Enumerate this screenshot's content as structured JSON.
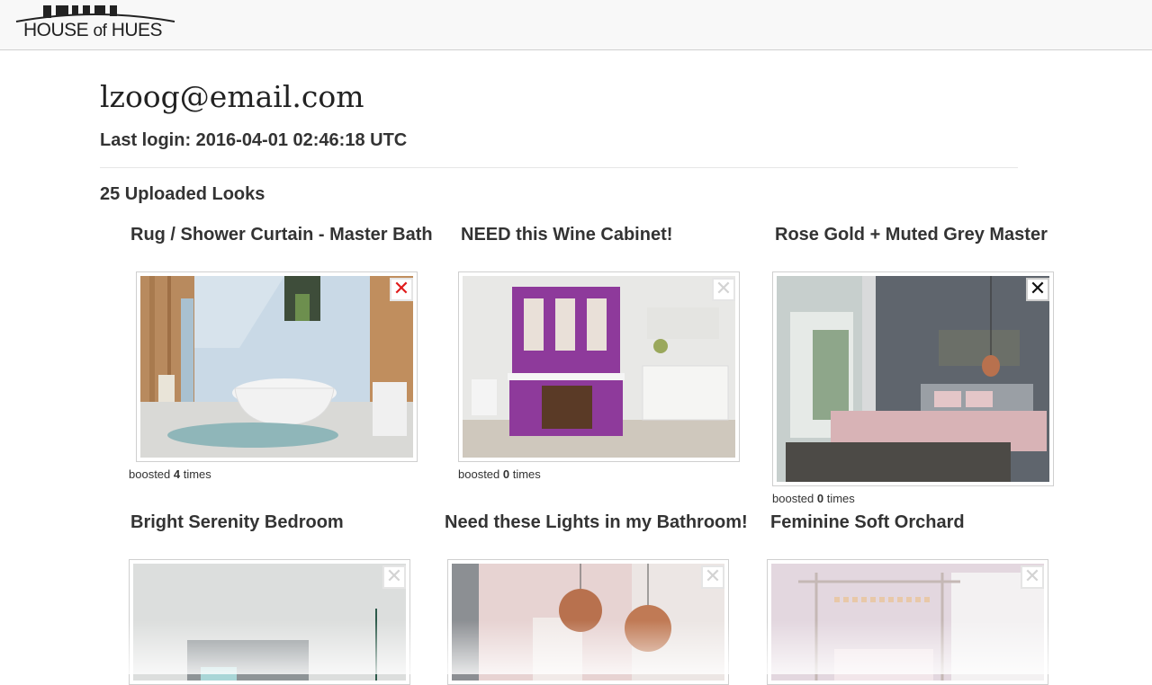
{
  "header": {
    "logo_text_1": "HOUSE ",
    "logo_text_of": "of",
    "logo_text_2": " HUES"
  },
  "profile": {
    "email": "lzoog@email.com",
    "last_login": "Last login: 2016-04-01 02:46:18 UTC"
  },
  "uploads": {
    "heading": "25 Uploaded Looks",
    "looks": [
      {
        "title": "Rug / Shower Curtain - Master Bath",
        "boost_prefix": "boosted ",
        "boost_count": "4",
        "boost_suffix": " times",
        "remove_icon": "close-icon-red"
      },
      {
        "title": "NEED this Wine Cabinet!",
        "boost_prefix": "boosted ",
        "boost_count": "0",
        "boost_suffix": " times",
        "remove_icon": "close-icon-gray"
      },
      {
        "title": "Rose Gold + Muted Grey Master",
        "boost_prefix": "boosted ",
        "boost_count": "0",
        "boost_suffix": " times",
        "remove_icon": "close-icon-black"
      },
      {
        "title": "Bright Serenity Bedroom",
        "remove_icon": "close-icon-gray"
      },
      {
        "title": "Need these Lights in my Bathroom!",
        "remove_icon": "close-icon-gray"
      },
      {
        "title": "Feminine Soft Orchard",
        "remove_icon": "close-icon-gray"
      }
    ]
  },
  "remove_glyph": "✕",
  "colors": {
    "remove_red": "#e01b1b",
    "remove_gray": "#d3d3d3",
    "remove_black": "#111111",
    "cabinet_purple": "#8e3a9b",
    "copper": "#b8714e"
  }
}
